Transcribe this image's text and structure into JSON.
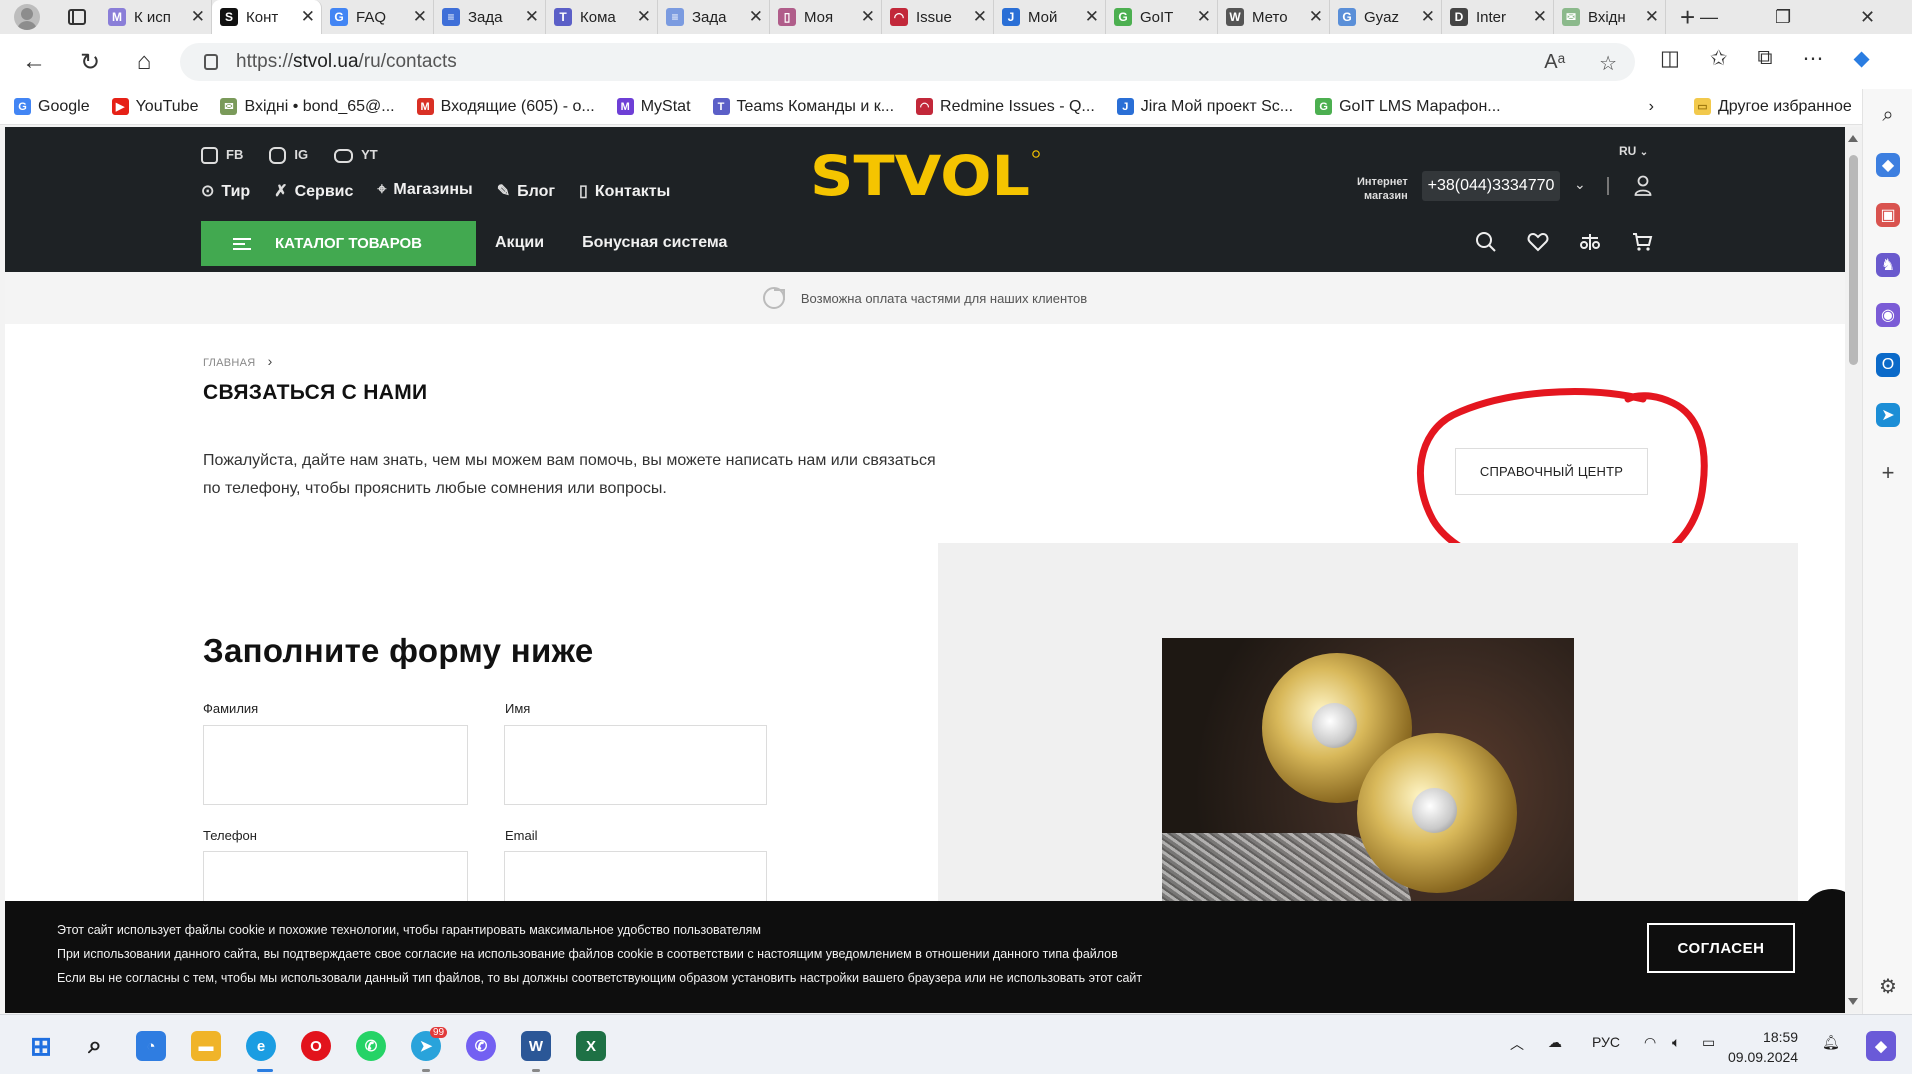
{
  "browser": {
    "tabs": [
      {
        "label": "К исп",
        "fav_color": "#8a7ed8",
        "fav_char": "M"
      },
      {
        "label": "Конт",
        "fav_color": "#111111",
        "fav_char": "S",
        "active": true
      },
      {
        "label": "FAQ",
        "fav_color": "#4285f4",
        "fav_char": "G"
      },
      {
        "label": "Зада",
        "fav_color": "#3f6fd8",
        "fav_char": "≡"
      },
      {
        "label": "Кома",
        "fav_color": "#5b5fc7",
        "fav_char": "T"
      },
      {
        "label": "Зада",
        "fav_color": "#7b9be0",
        "fav_char": "≡"
      },
      {
        "label": "Моя",
        "fav_color": "#b05d8a",
        "fav_char": "▯"
      },
      {
        "label": "Issue",
        "fav_color": "#c2283a",
        "fav_char": "◠"
      },
      {
        "label": "Мой",
        "fav_color": "#2a6fd6",
        "fav_char": "J"
      },
      {
        "label": "GoIT",
        "fav_color": "#4caf50",
        "fav_char": "G"
      },
      {
        "label": "Мето",
        "fav_color": "#555555",
        "fav_char": "W"
      },
      {
        "label": "Gyaz",
        "fav_color": "#5a8fd8",
        "fav_char": "G"
      },
      {
        "label": "Inter",
        "fav_color": "#444444",
        "fav_char": "D"
      },
      {
        "label": "Вхідн",
        "fav_color": "#8bb98b",
        "fav_char": "✉"
      }
    ],
    "url_prefix": "https://",
    "url_host": "stvol.ua",
    "url_path": "/ru/contacts",
    "bookmarks": [
      {
        "label": "Google",
        "color": "#4285f4",
        "char": "G"
      },
      {
        "label": "YouTube",
        "color": "#e62117",
        "char": "▶"
      },
      {
        "label": "Вхідні • bond_65@...",
        "color": "#7a9a5a",
        "char": "✉"
      },
      {
        "label": "Входящие (605) - о...",
        "color": "#d93025",
        "char": "M"
      },
      {
        "label": "MyStat",
        "color": "#6e3fd6",
        "char": "M"
      },
      {
        "label": "Teams Команды и к...",
        "color": "#5b5fc7",
        "char": "T"
      },
      {
        "label": "Redmine  Issues - Q...",
        "color": "#c2283a",
        "char": "◠"
      },
      {
        "label": "Jira  Мой проект Sc...",
        "color": "#2a6fd6",
        "char": "J"
      },
      {
        "label": "GoIT LMS Марафон...",
        "color": "#4caf50",
        "char": "G"
      }
    ],
    "other_bookmarks": "Другое избранное"
  },
  "site": {
    "social": [
      "FB",
      "IG",
      "YT"
    ],
    "nav": [
      {
        "label": "Тир",
        "icon": "target-icon"
      },
      {
        "label": "Сервис",
        "icon": "wrench-icon"
      },
      {
        "label": "Магазины",
        "icon": "pin-icon"
      },
      {
        "label": "Блог",
        "icon": "pen-icon"
      },
      {
        "label": "Контакты",
        "icon": "phone-icon"
      }
    ],
    "logo_text": "STVOL",
    "lang": "RU",
    "shop_label_1": "Интернет",
    "shop_label_2": "магазин",
    "phone": "+38(044)3334770",
    "catalog_label": "КАТАЛОГ ТОВАРОВ",
    "subnav": [
      "Акции",
      "Бонусная система"
    ],
    "brand_color": "#f5c400",
    "green": "#42a950",
    "promo": "Возможна оплата частями для наших клиентов"
  },
  "page": {
    "breadcrumb": "ГЛАВНАЯ",
    "title": "СВЯЗАТЬСЯ С НАМИ",
    "intro": "Пожалуйста, дайте нам знать, чем мы можем вам помочь, вы можете написать нам или связаться по телефону, чтобы прояснить любые сомнения или вопросы.",
    "help_center": "СПРАВОЧНЫЙ ЦЕНТР",
    "form_title": "Заполните форму ниже",
    "fields": {
      "last_name": "Фамилия",
      "first_name": "Имя",
      "phone": "Телефон",
      "email": "Email"
    }
  },
  "cookie": {
    "line1": "Этот сайт использует файлы cookie и похожие технологии, чтобы гарантировать максимальное удобство пользователям",
    "line2": "При использовании данного сайта, вы подтверждаете свое согласие на использование файлов cookie в соответствии с настоящим уведомлением в отношении данного типа файлов",
    "line3": "Если вы не согласны с тем, чтобы мы использовали данный тип файлов, то вы должны соответствующим образом установить настройки вашего браузера или не использовать этот сайт",
    "agree": "СОГЛАСЕН"
  },
  "taskbar": {
    "lang": "РУС",
    "time": "18:59",
    "date": "09.09.2024",
    "telegram_badge": "99"
  }
}
